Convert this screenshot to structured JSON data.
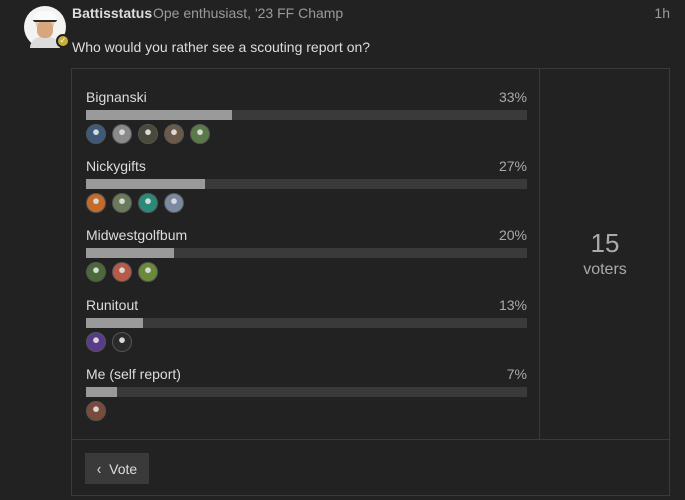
{
  "post": {
    "username": "Battisstatus",
    "user_title": "Ope enthusiast, '23 FF Champ",
    "time": "1h",
    "question": "Who would you rather see a scouting report on?"
  },
  "poll": {
    "options": [
      {
        "label": "Bignanski",
        "percent": "33%",
        "fraction": 0.33,
        "voter_avatars": [
          "#3d5a7a",
          "#8a8a8a",
          "#4a4a3a",
          "#6b5a4a",
          "#5a7a4a"
        ]
      },
      {
        "label": "Nickygifts",
        "percent": "27%",
        "fraction": 0.27,
        "voter_avatars": [
          "#c46a2a",
          "#6a7a5a",
          "#2a8a7a",
          "#7a8aa0"
        ]
      },
      {
        "label": "Midwestgolfbum",
        "percent": "20%",
        "fraction": 0.2,
        "voter_avatars": [
          "#4a6a3a",
          "#b85a4a",
          "#6a8a3a"
        ]
      },
      {
        "label": "Runitout",
        "percent": "13%",
        "fraction": 0.13,
        "voter_avatars": [
          "#5a3a8a",
          "#2a2a2a"
        ]
      },
      {
        "label": "Me (self report)",
        "percent": "7%",
        "fraction": 0.07,
        "voter_avatars": [
          "#7a4a3a"
        ]
      }
    ],
    "voter_count": "15",
    "voter_label": "voters",
    "vote_button": "Vote"
  },
  "colors": {
    "background": "#222222",
    "bar_track": "#3a3a3a",
    "bar_fill": "#9a9a9a",
    "text": "#dddddd",
    "muted": "#9a9a9a"
  }
}
